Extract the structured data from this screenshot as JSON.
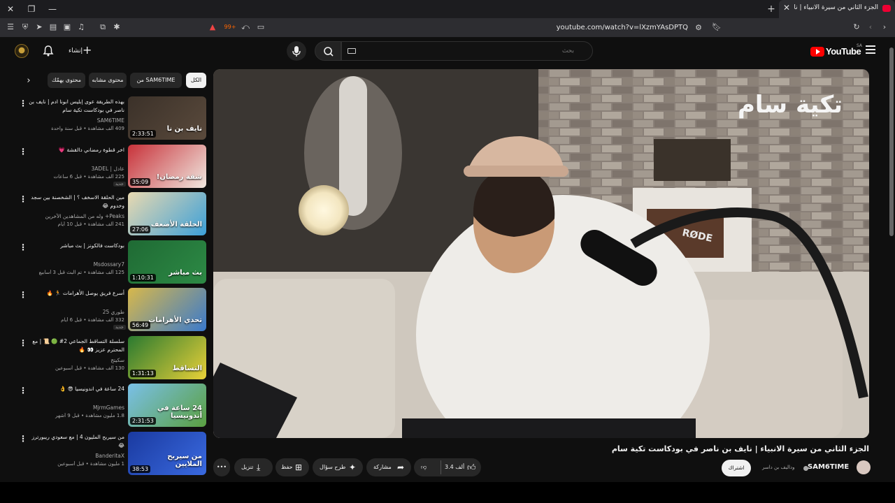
{
  "browser": {
    "tab_title": "الجزء الثاني من سيرة الانبياء | نايف",
    "url": "youtube.com/watch?v=lXzmYAsDPTQ",
    "shield_count": "99+"
  },
  "header": {
    "logo_text": "YouTube",
    "region": "SA",
    "search_placeholder": "بحث",
    "create_label": "إنشاء"
  },
  "chips": [
    {
      "label": "الكل"
    },
    {
      "label": "من SAM6TIME"
    },
    {
      "label": "محتوى مشابه"
    },
    {
      "label": "محتوى يهمّك"
    }
  ],
  "related": [
    {
      "title": "بهذه الطريقة عوى إبليس ابونا ادم | نايف بن ناصر في بودكاست تكية سام",
      "channel": "SAM6TIME",
      "meta": "409 ألف مشاهدة • قبل سنة واحدة",
      "duration": "2:33:51",
      "badge": "",
      "thumb_colors": [
        "#3b3129",
        "#5a4a3c"
      ],
      "thumb_text": "نايف بن نا"
    },
    {
      "title": "اخر قطوة رمضاني دالقشة 💗",
      "channel": "عادل | 3ADEL",
      "meta": "225 ألف مشاهدة • قبل 6 ساعات",
      "duration": "35:09",
      "badge": "جديد",
      "thumb_colors": [
        "#c8323a",
        "#f0e8e0"
      ],
      "thumb_text": "شقة رمضان!"
    },
    {
      "title": "مين الحلقة الاسخف ؟ | الشخصنة بين سجد وخدوم 😂",
      "channel": "Peaks+ وله من المشاهدين الآخرين",
      "meta": "241 ألف مشاهدة • قبل 10 أيام",
      "duration": "27:06",
      "badge": "",
      "thumb_colors": [
        "#e9d9b0",
        "#3ca0d8"
      ],
      "thumb_text": "الحلقة الأضعف"
    },
    {
      "title": "بودكاست فالكونز | بث مباشر",
      "channel": "Msdossary7",
      "meta": "125 ألف مشاهدة • تم البث قبل 3 أسابيع",
      "duration": "1:10:31",
      "badge": "",
      "thumb_colors": [
        "#1f6a34",
        "#2d8a45"
      ],
      "thumb_text": "بث مباشر"
    },
    {
      "title": "أسرع فريق يوصل الأهرامات 🏃 🔥",
      "channel": "طوري 25",
      "meta": "332 ألف مشاهدة • قبل 6 أيام",
      "duration": "56:49",
      "badge": "جديد",
      "thumb_colors": [
        "#d8b84a",
        "#3a7acc"
      ],
      "thumb_text": "تحدي الأهرامات"
    },
    {
      "title": "سلسلة التساقط الجماعي 2# 🟢 📜 | مع المحترم عزيز 👀 🔥",
      "channel": "سكيتج",
      "meta": "130 ألف مشاهدة • قبل أسبوعين",
      "duration": "1:31:13",
      "badge": "",
      "thumb_colors": [
        "#2a7a30",
        "#e8d038"
      ],
      "thumb_text": "التساقط"
    },
    {
      "title": "24 ساعة في اندونيسيا 😎 👌",
      "channel": "MjrmGames",
      "meta": "1.8 مليون مشاهدة • قبل 9 أشهر",
      "duration": "2:31:53",
      "badge": "",
      "thumb_colors": [
        "#7ac0e8",
        "#5aa040"
      ],
      "thumb_text": "24 ساعة في أندونيسيا"
    },
    {
      "title": "من سيربح المليون 4 | مع سعودي ريبورترز 😂",
      "channel": "BanderitaX",
      "meta": "1 مليون مشاهدة • قبل أسبوعين",
      "duration": "38:53",
      "badge": "",
      "thumb_colors": [
        "#1a3aa0",
        "#3a6ae0"
      ],
      "thumb_text": "من سيربح الملايين"
    }
  ],
  "video": {
    "title": "الجزء الثاني من سيرة الانبياء | نايف بن ناصر في بودكاست تكية سام",
    "channel": "SAM6TIME",
    "channel_subs": "وداليف بن داسر",
    "subscribe_label": "اشتراك",
    "likes": "3.4 ألف",
    "share_label": "مشاركة",
    "ask_label": "طرح سؤال",
    "save_label": "حفظ",
    "download_label": "تنزيل",
    "watermark": "تكية سام",
    "mic_brand": "RØDE"
  }
}
